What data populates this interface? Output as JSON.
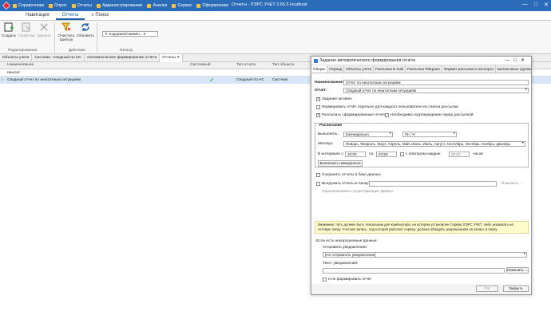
{
  "titlebar": {
    "menu": [
      "Справочники",
      "Опрос",
      "Отчеты",
      "Администрирование",
      "Анализ",
      "Сервис",
      "Оформление"
    ],
    "title": "Отчеты - ЛЭРС УЧЕТ 3.65.5 localhost",
    "winbtns": [
      "—",
      "□",
      "✕"
    ]
  },
  "ribbon_tabs": [
    "Навигация",
    "Отчеты",
    "Поиск"
  ],
  "ribbon": {
    "create": "Создать",
    "properties": "Свойства",
    "delete": "Удалить",
    "clear_filter": "Очистить фильтр",
    "refresh": "Обновить",
    "group_edit": "Редактирование",
    "group_actions": "Действия",
    "group_filter": "Фильтр",
    "filter_value": "Содержит(Наимен..."
  },
  "doc_tabs": [
    "Объекты учета",
    "Система - Сводный по НС",
    "Автоматическое формирование отчёта",
    "Отчеты"
  ],
  "grid": {
    "columns": [
      "Наименование",
      "Системный",
      "Тип отчета",
      "Тип объекта"
    ],
    "filter_text": "нештат",
    "rows": [
      {
        "name": "Сводный отчет по нештатным ситуациям",
        "type": "Сводный по НС",
        "object": "Система"
      }
    ]
  },
  "dialog": {
    "title": "Задание автоматического формирования отчёта",
    "winbtns": "—□✕",
    "tabs": [
      "Общие",
      "Период",
      "Объекты учета",
      "Рассылка E-mail",
      "Рассылка Telegram",
      "Формат рассылки и экспорта",
      "Балансовые группы"
    ],
    "name_label": "Наименование:",
    "name_value": "Отчет по нештатным ситуациям",
    "report_label": "Отчет:",
    "report_value": "Сводный отчет по нештатным ситуациям",
    "active": "Задание активно",
    "per_user": "Формировать отчёт отдельно для каждого пользователя из списка рассылки",
    "send_reports": "Рассылать сформированные отчеты",
    "confirm": "Необходимо подтверждение перед рассылкой",
    "schedule": "Расписание",
    "run_label": "Выполнять:",
    "run_value": "Еженедельно",
    "days_value": "Пн, Чт",
    "months_label": "Месяцы:",
    "months_value": "Январь, Февраль, Март, Апрель, Май, Июнь, Июль, Август, Сентябрь, Октябрь, Ноябрь, Декабрь",
    "interval_label": "В интервале с:",
    "from": "10:00",
    "to_label": "по:",
    "to": "23:59",
    "repeat_label": "с повтором каждые:",
    "repeat_value": "00:00",
    "hours": "часов",
    "run_now": "Выполнить немедленно",
    "save_db": "Сохранять отчеты в базе данных",
    "export_folder": "Выгружать отчеты в папку:",
    "change_btn": "Изменить ...",
    "overwrite": "Перезаписывать существующие файлы",
    "warning": "Внимание: путь должен быть локальным для компьютера, на котором установлен Сервер ЛЭРС УЧЕТ, либо указывать на сетевую папку. Учетная запись, под которой работает сервер, должна обладать разрешением на запись в папку.",
    "no_data_label": "Если есть неопрошенные данные:",
    "notify_label": "Отправить уведомление:",
    "notify_value": "[Не отправлять уведомление]",
    "notify_text_label": "Текст уведомления:",
    "notify_change": "Изменить ...",
    "no_report": "и не формировать отчёт",
    "ok": "ОК",
    "close": "Закрыть"
  }
}
